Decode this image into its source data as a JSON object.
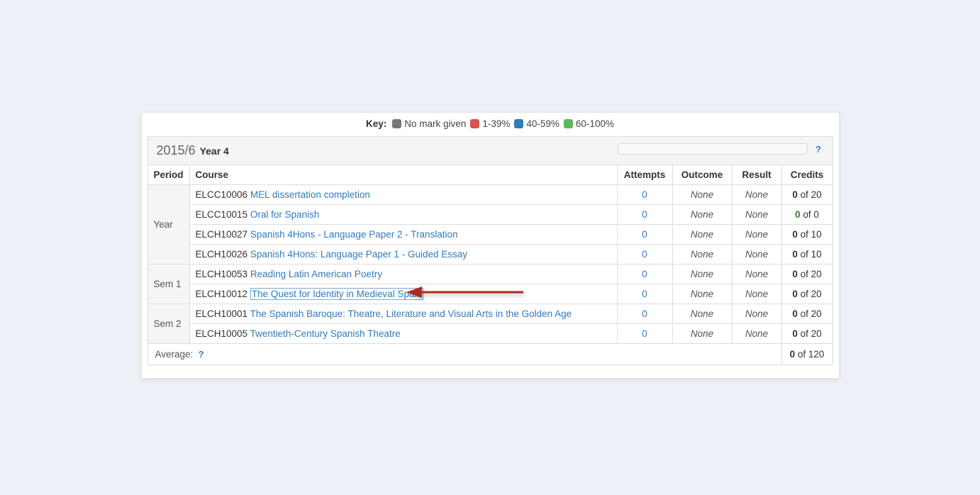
{
  "key": {
    "label": "Key:",
    "none": "No mark given",
    "low": "1-39%",
    "mid": "40-59%",
    "high": "60-100%"
  },
  "header": {
    "year_code": "2015/6",
    "year_label": "Year 4"
  },
  "columns": {
    "period": "Period",
    "course": "Course",
    "attempts": "Attempts",
    "outcome": "Outcome",
    "result": "Result",
    "credits": "Credits"
  },
  "groups": [
    {
      "period": "Year",
      "rows": [
        {
          "code": "ELCC10006",
          "title": "MEL dissertation completion",
          "attempts": "0",
          "outcome": "None",
          "result": "None",
          "credits_status": "normal",
          "credits_gained": "0",
          "credits_total": "20",
          "highlighted": false
        },
        {
          "code": "ELCC10015",
          "title": "Oral for Spanish",
          "attempts": "0",
          "outcome": "None",
          "result": "None",
          "credits_status": "green",
          "credits_gained": "0",
          "credits_total": "0",
          "highlighted": false
        },
        {
          "code": "ELCH10027",
          "title": "Spanish 4Hons - Language Paper 2 - Translation",
          "attempts": "0",
          "outcome": "None",
          "result": "None",
          "credits_status": "normal",
          "credits_gained": "0",
          "credits_total": "10",
          "highlighted": false
        },
        {
          "code": "ELCH10026",
          "title": "Spanish 4Hons: Language Paper 1 - Guided Essay",
          "attempts": "0",
          "outcome": "None",
          "result": "None",
          "credits_status": "normal",
          "credits_gained": "0",
          "credits_total": "10",
          "highlighted": false
        }
      ]
    },
    {
      "period": "Sem 1",
      "rows": [
        {
          "code": "ELCH10053",
          "title": "Reading Latin American Poetry",
          "attempts": "0",
          "outcome": "None",
          "result": "None",
          "credits_status": "normal",
          "credits_gained": "0",
          "credits_total": "20",
          "highlighted": false
        },
        {
          "code": "ELCH10012",
          "title": "The Quest for Identity in Medieval Spain",
          "attempts": "0",
          "outcome": "None",
          "result": "None",
          "credits_status": "normal",
          "credits_gained": "0",
          "credits_total": "20",
          "highlighted": true
        }
      ]
    },
    {
      "period": "Sem 2",
      "rows": [
        {
          "code": "ELCH10001",
          "title": "The Spanish Baroque: Theatre, Literature and Visual Arts in the Golden Age",
          "attempts": "0",
          "outcome": "None",
          "result": "None",
          "credits_status": "normal",
          "credits_gained": "0",
          "credits_total": "20",
          "highlighted": false
        },
        {
          "code": "ELCH10005",
          "title": "Twentieth-Century Spanish Theatre",
          "attempts": "0",
          "outcome": "None",
          "result": "None",
          "credits_status": "normal",
          "credits_gained": "0",
          "credits_total": "20",
          "highlighted": false
        }
      ]
    }
  ],
  "footer": {
    "label": "Average:",
    "credits_gained": "0",
    "credits_total": "120"
  },
  "text": {
    "of": "of"
  },
  "icons": {
    "help": "?"
  }
}
